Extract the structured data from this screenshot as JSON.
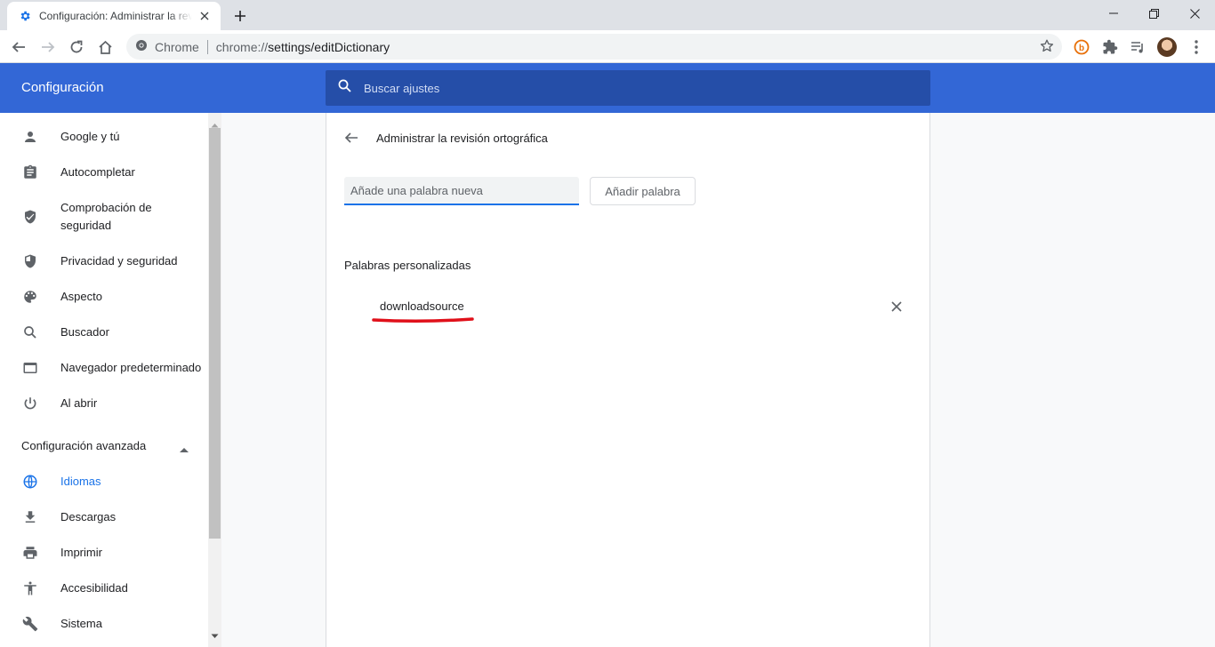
{
  "browser": {
    "tab_title": "Configuración: Administrar la revisión ortográfica",
    "site_label": "Chrome",
    "url_scheme": "chrome://",
    "url_path": "settings/editDictionary"
  },
  "settings": {
    "app_title": "Configuración",
    "search_placeholder": "Buscar ajustes",
    "sidebar": {
      "items": [
        {
          "label": "Google y tú",
          "icon": "person-icon"
        },
        {
          "label": "Autocompletar",
          "icon": "clipboard-icon"
        },
        {
          "label": "Comprobación de seguridad",
          "icon": "shield-check-icon"
        },
        {
          "label": "Privacidad y seguridad",
          "icon": "shield-half-icon"
        },
        {
          "label": "Aspecto",
          "icon": "palette-icon"
        },
        {
          "label": "Buscador",
          "icon": "search-icon"
        },
        {
          "label": "Navegador predeterminado",
          "icon": "browser-icon"
        },
        {
          "label": "Al abrir",
          "icon": "power-icon"
        }
      ],
      "advanced_label": "Configuración avanzada",
      "advanced_items": [
        {
          "label": "Idiomas",
          "icon": "globe-icon",
          "active": true
        },
        {
          "label": "Descargas",
          "icon": "download-icon"
        },
        {
          "label": "Imprimir",
          "icon": "printer-icon"
        },
        {
          "label": "Accesibilidad",
          "icon": "accessibility-icon"
        },
        {
          "label": "Sistema",
          "icon": "wrench-icon"
        }
      ]
    },
    "page": {
      "title": "Administrar la revisión ortográfica",
      "new_word_placeholder": "Añade una palabra nueva",
      "add_button": "Añadir palabra",
      "custom_words_heading": "Palabras personalizadas",
      "custom_words": [
        "downloadsource"
      ]
    }
  },
  "colors": {
    "header_blue": "#3367d6",
    "search_blue": "#254ea8",
    "active_blue": "#1a73e8",
    "annotation_red": "#e0101a"
  }
}
